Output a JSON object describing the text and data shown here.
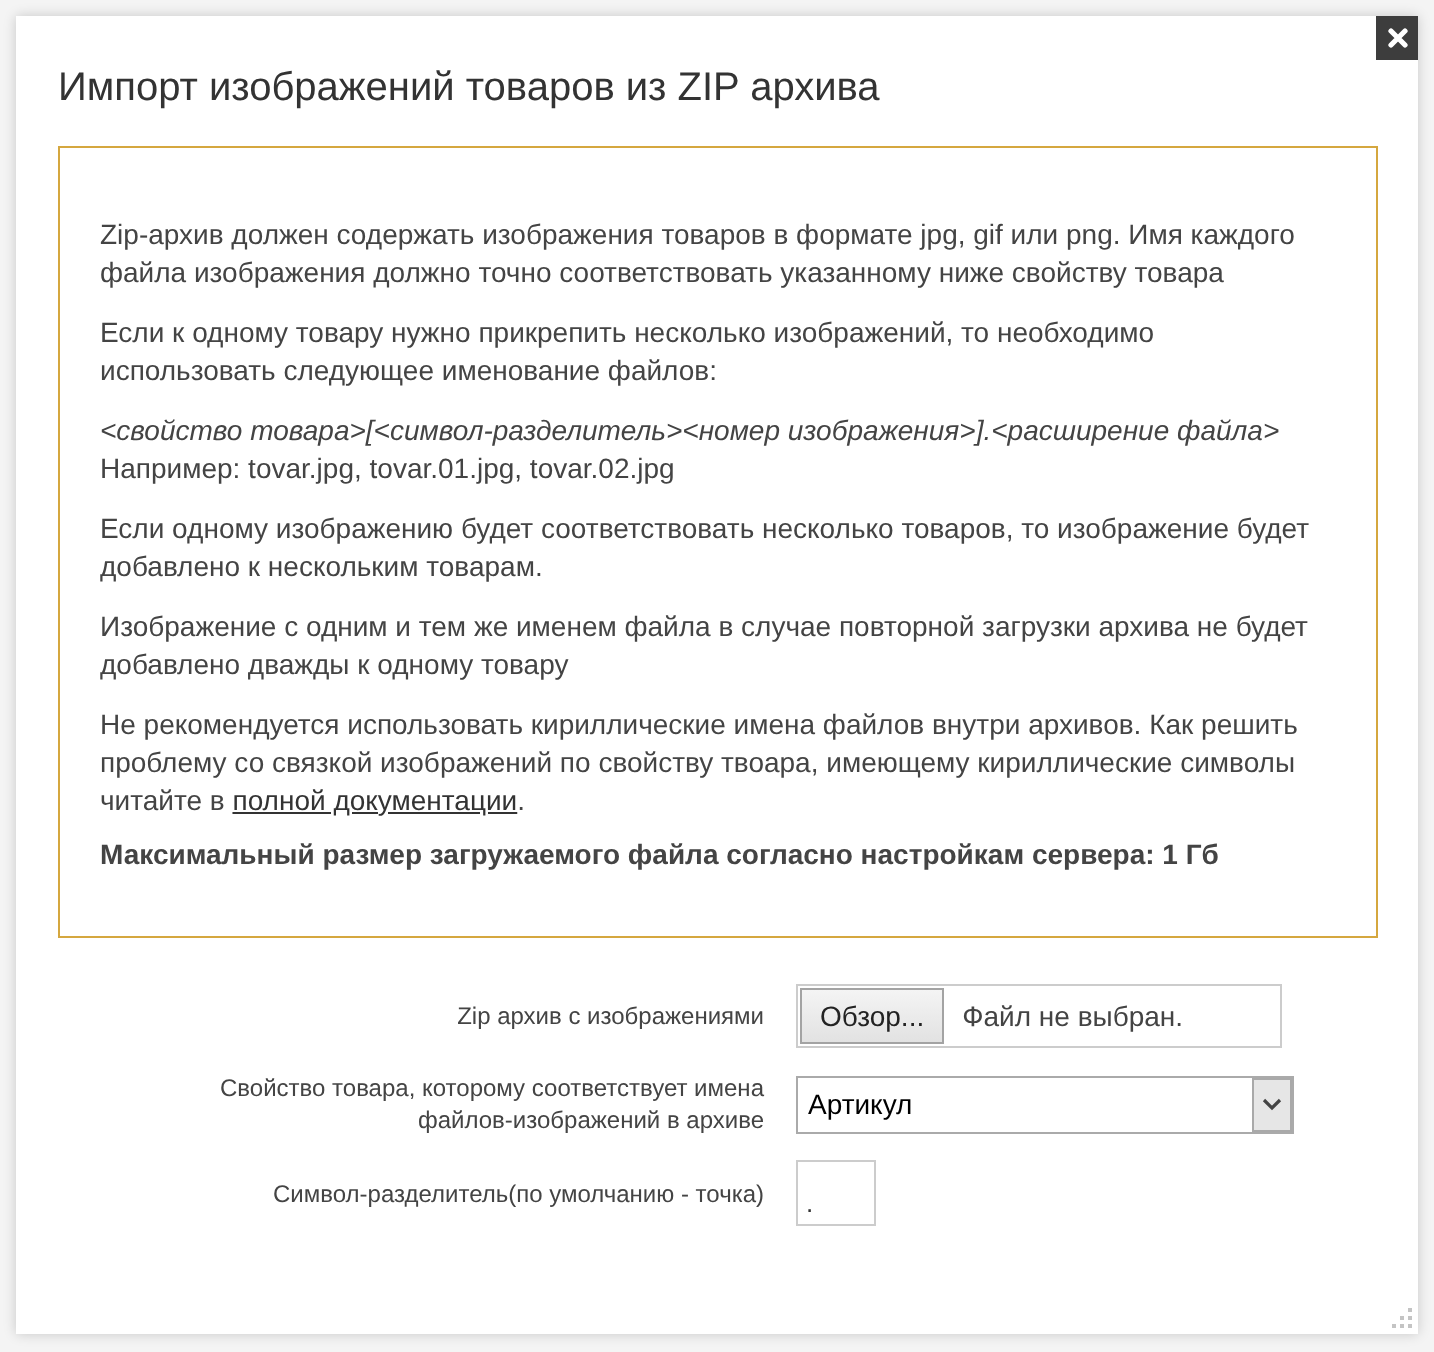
{
  "dialog": {
    "title": "Импорт изображений товаров из ZIP архива"
  },
  "info": {
    "paragraphs": [
      {
        "kind": "text",
        "text": "Zip-архив должен содержать изображения товаров в формате jpg, gif или png. Имя каждого файла изображения должно точно соответствовать указанному ниже свойству товара"
      },
      {
        "kind": "text",
        "text": "Если к одному товару нужно прикрепить несколько изображений, то необходимо использовать следующее именование файлов:"
      },
      {
        "kind": "pattern",
        "pattern": "<свойство товара>[<символ-разделитель><номер изображения>].<расширение файла>",
        "example": "Например: tovar.jpg, tovar.01.jpg, tovar.02.jpg"
      },
      {
        "kind": "text",
        "text": "Если одному изображению будет соответствовать несколько товаров, то изображение будет добавлено к нескольким товарам."
      },
      {
        "kind": "text",
        "text": "Изображение с одним и тем же именем файла в случае повторной загрузки архива не будет добавлено дважды к одному товару"
      },
      {
        "kind": "link",
        "text": "Не рекомендуется использовать кириллические имена файлов внутри архивов. Как решить проблему со связкой изображений по свойству твоара, имеющему кириллические символы читайте в ",
        "link": "полной документации",
        "after": "."
      },
      {
        "kind": "bold",
        "text": "Максимальный размер загружаемого файла согласно настройкам сервера: 1 Гб"
      }
    ]
  },
  "form": {
    "fields": [
      {
        "kind": "file",
        "label": "Zip архив с изображениями",
        "button": "Обзор...",
        "status": "Файл не выбран."
      },
      {
        "kind": "select",
        "label": "Свойство товара, которому соответствует имена файлов-изображений в архиве",
        "value": "Артикул"
      },
      {
        "kind": "text",
        "label": "Символ-разделитель(по умолчанию - точка)",
        "value": "."
      }
    ]
  }
}
